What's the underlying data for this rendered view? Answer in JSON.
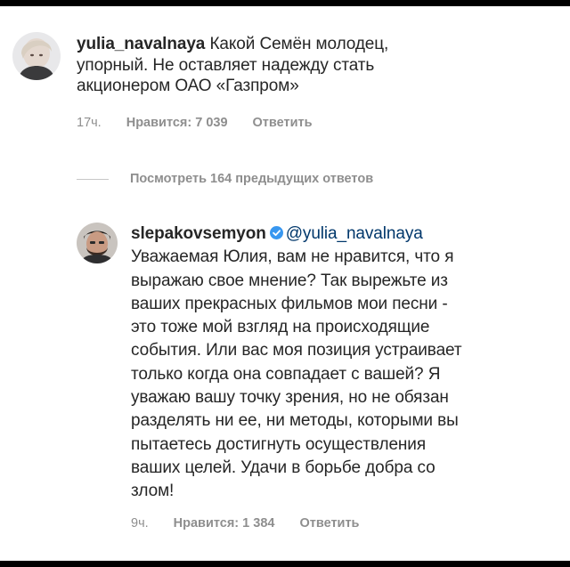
{
  "comment1": {
    "username": "yulia_navalnaya",
    "text_line1": " Какой Семён молодец,",
    "text_line2": "упорный. Не оставляет надежду стать",
    "text_line3": "акционером  ОАО «Газпром»",
    "time": "17ч.",
    "likes": "Нравится: 7 039",
    "reply": "Ответить"
  },
  "view_replies": {
    "label": "Посмотреть 164 предыдущих ответов"
  },
  "comment2": {
    "username": "slepakovsemyon",
    "mention": "@yulia_navalnaya",
    "lines": [
      "Уважаемая Юлия, вам не нравится, что я",
      "выражаю свое мнение? Так вырежьте из",
      "ваших прекрасных фильмов мои песни -",
      "это тоже мой взгляд на происходящие",
      "события. Или вас моя позиция устраивает",
      "только когда она совпадает с вашей? Я",
      "уважаю вашу точку зрения, но не обязан",
      "разделять ни ее, ни методы, которыми вы",
      "пытаетесь достигнуть осуществления",
      "ваших целей. Удачи в борьбе добра со",
      "злом!"
    ],
    "time": "9ч.",
    "likes": "Нравится: 1 384",
    "reply": "Ответить"
  },
  "icons": {
    "verified": "verified-badge-icon",
    "verified_color": "#3897f0"
  }
}
